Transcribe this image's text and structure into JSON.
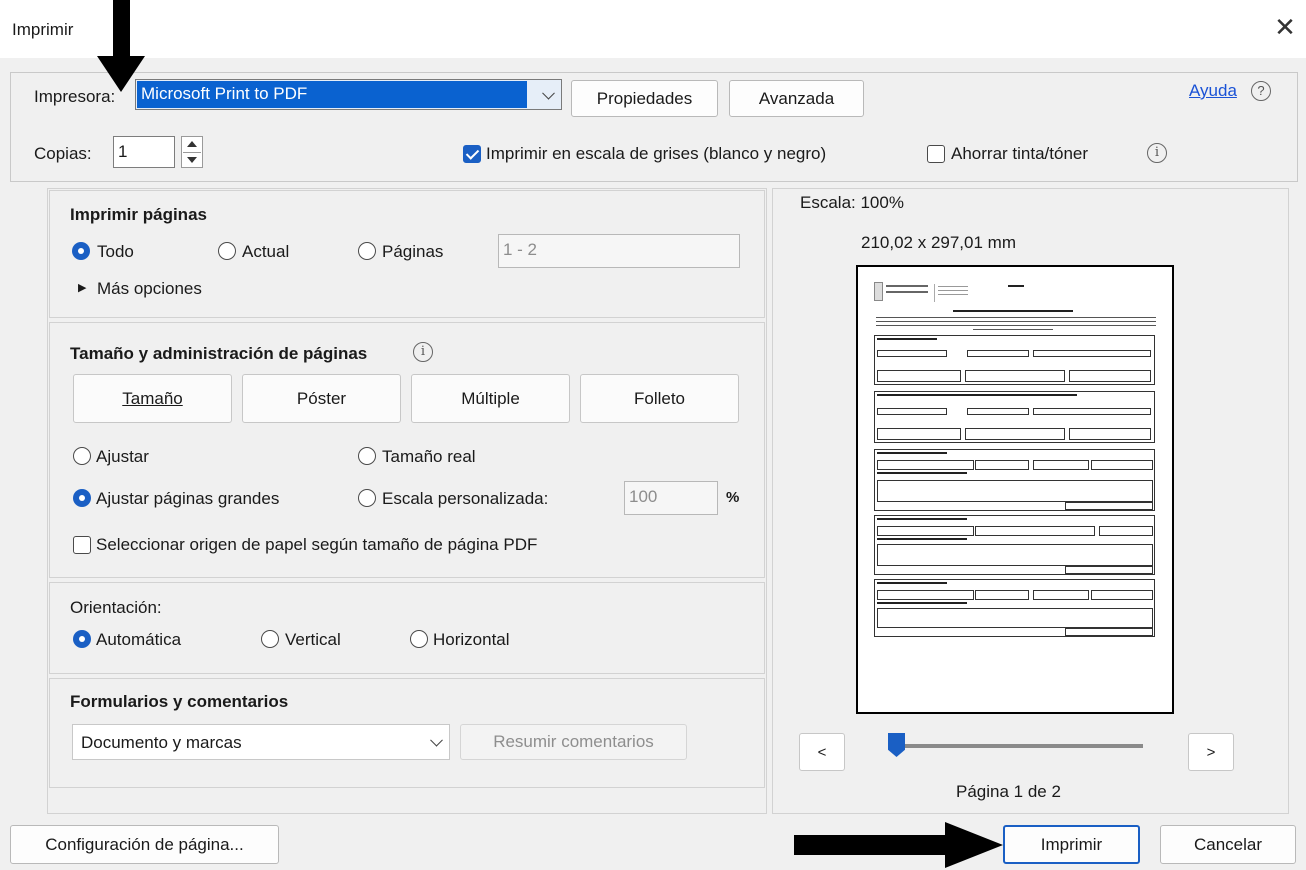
{
  "window": {
    "title": "Imprimir",
    "close_glyph": "✕"
  },
  "printer": {
    "label": "Impresora:",
    "selected": "Microsoft Print to PDF",
    "properties_button": "Propiedades",
    "advanced_button": "Avanzada",
    "help_link": "Ayuda",
    "help_icon_glyph": "?"
  },
  "copies": {
    "label": "Copias:",
    "value": "1"
  },
  "options": {
    "grayscale_label": "Imprimir en escala de grises (blanco y negro)",
    "grayscale_checked": true,
    "save_ink_label": "Ahorrar tinta/tóner",
    "save_ink_checked": false,
    "info_glyph": "i"
  },
  "pages_section": {
    "heading": "Imprimir páginas",
    "all_label": "Todo",
    "current_label": "Actual",
    "pages_label": "Páginas",
    "pages_range_value": "1 - 2",
    "more_options": "Más opciones",
    "more_options_glyph": "▶",
    "selected": "all"
  },
  "size_section": {
    "heading": "Tamaño y administración de páginas",
    "tabs": [
      "Tamaño",
      "Póster",
      "Múltiple",
      "Folleto"
    ],
    "fit_label": "Ajustar",
    "actual_size_label": "Tamaño real",
    "shrink_large_label": "Ajustar páginas grandes",
    "custom_scale_label": "Escala personalizada:",
    "custom_scale_value": "100",
    "percent": "%",
    "paper_source_label": "Seleccionar origen de papel según tamaño de página PDF",
    "selected": "shrink_large"
  },
  "orientation": {
    "heading": "Orientación:",
    "auto_label": "Automática",
    "vertical_label": "Vertical",
    "horizontal_label": "Horizontal",
    "selected": "auto"
  },
  "forms": {
    "heading": "Formularios y comentarios",
    "selected": "Documento y marcas",
    "summarize_button": "Resumir comentarios"
  },
  "preview": {
    "scale_text": "Escala: 100%",
    "dimensions": "210,02 x 297,01 mm",
    "prev_glyph": "<",
    "next_glyph": ">",
    "page_status": "Página 1 de 2",
    "slider_position": 0
  },
  "footer": {
    "page_setup_button": "Configuración de página...",
    "print_button": "Imprimir",
    "cancel_button": "Cancelar"
  },
  "colors": {
    "accent": "#1a5fc4",
    "selection": "#0a62d0",
    "link": "#1a52d6"
  }
}
